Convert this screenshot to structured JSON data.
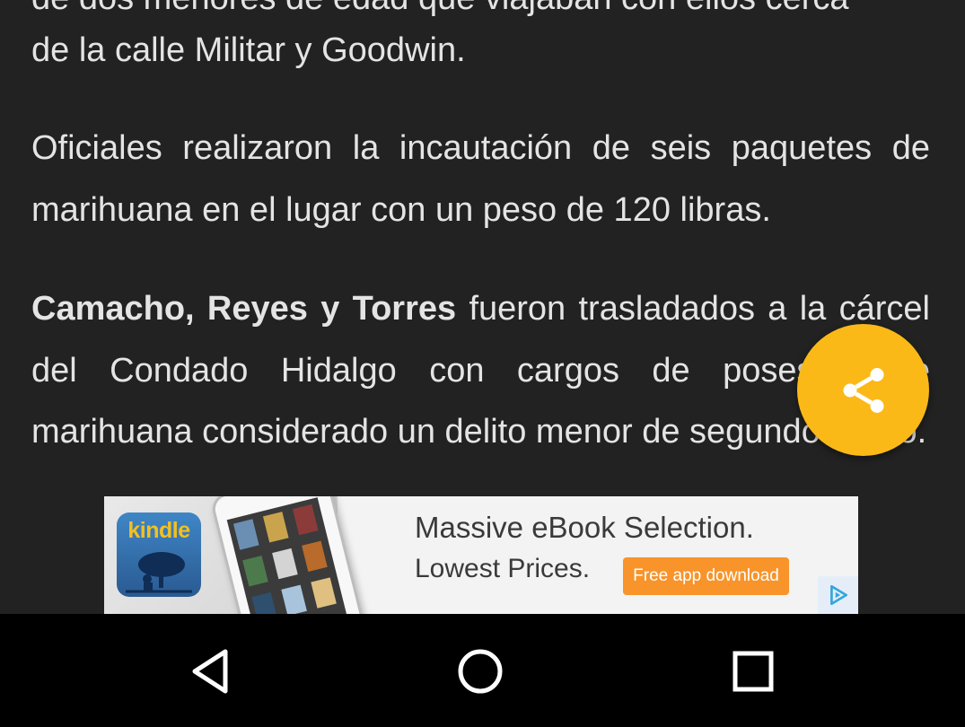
{
  "article": {
    "paragraph1_clipped": "de dos menores de edad que viajaban con ellos cerca",
    "paragraph1_last": "de la calle Militar y Goodwin.",
    "paragraph2": "Oficiales realizaron la incautación de seis paquetes de marihuana en el lugar con un peso de 120 libras.",
    "paragraph3_bold": "Camacho, Reyes y Torres",
    "paragraph3_rest": " fueron trasladados a la cárcel del Condado Hidalgo con cargos de posesión de marihuana considerado un delito menor de segundo grado."
  },
  "share_button": {
    "icon": "share-icon",
    "color": "#fbb918"
  },
  "ad": {
    "brand": "kindle",
    "headline": "Massive eBook Selection.",
    "subline": "Lowest Prices.",
    "cta": "Free app download",
    "cta_color": "#f8942a",
    "adchoices_icon": "adchoices-icon"
  },
  "navbar": {
    "back_icon": "back-icon",
    "home_icon": "home-icon",
    "recents_icon": "recents-icon"
  }
}
